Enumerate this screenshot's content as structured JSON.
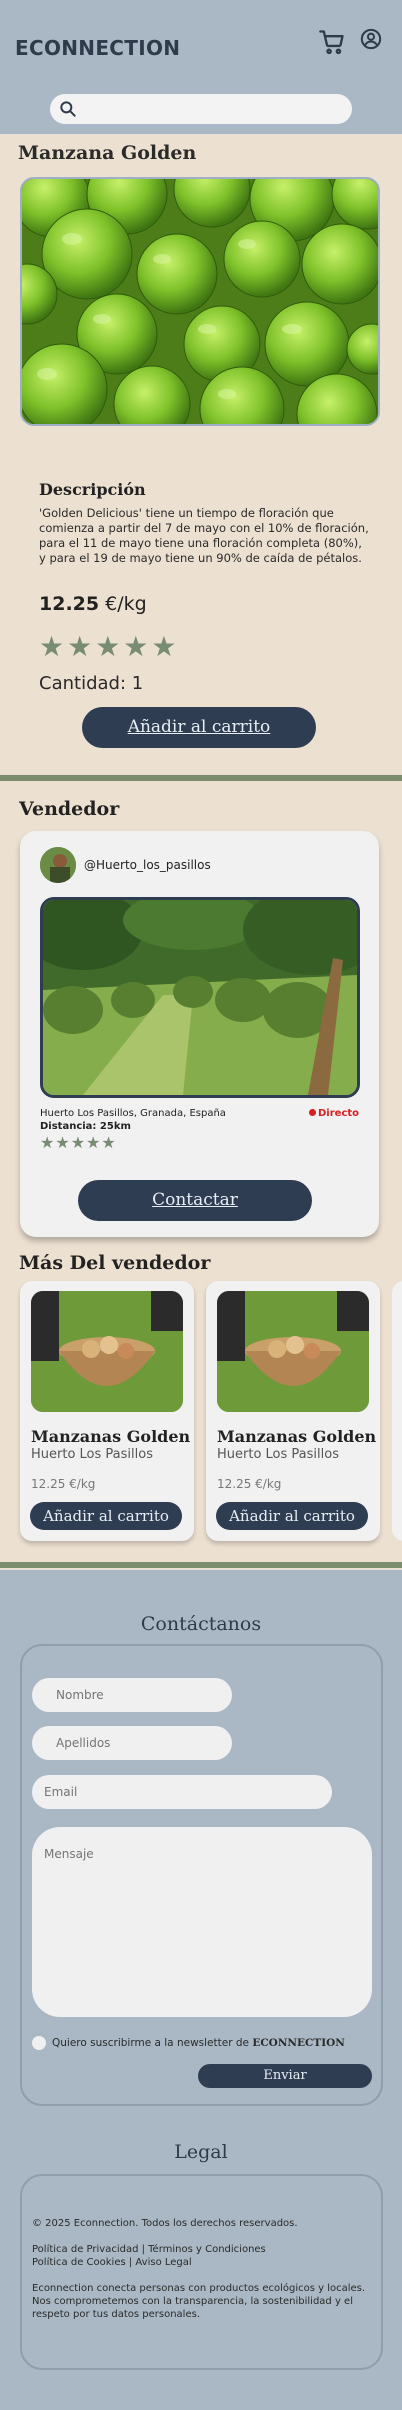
{
  "header": {
    "brand": "ECONNECTION",
    "cart_icon": "cart-icon",
    "user_icon": "user-icon",
    "search_placeholder": ""
  },
  "product": {
    "title": "Manzana Golden",
    "image": "green-apples-photo",
    "description_title": "Descripción",
    "description": "'Golden Delicious' tiene un tiempo de floración que comienza a partir del 7 de mayo con el 10% de floración, para el 11 de mayo tiene una floración completa (80%), y para el 19 de mayo tiene un 90% de caída de pétalos.",
    "price_value": "12.25",
    "price_unit": " €/kg",
    "rating": 5,
    "stars": "★★★★★",
    "quantity": "Cantidad: 1",
    "add_button": "Añadir al carrito"
  },
  "vendor": {
    "section_title": "Vendedor",
    "handle": "@Huerto_los_pasillos",
    "location": "Huerto Los Pasillos, Granada, España",
    "distance": "Distancia: 25km",
    "live": "Directo",
    "rating": 5,
    "stars": "★★★★★",
    "contact_button": "Contactar"
  },
  "more": {
    "section_title": "Más Del vendedor",
    "items": [
      {
        "title": "Manzanas Golden",
        "seller": "Huerto Los Pasillos",
        "price": "12.25 €/kg",
        "button": "Añadir al carrito"
      },
      {
        "title": "Manzanas Golden",
        "seller": "Huerto Los Pasillos",
        "price": "12.25 €/kg",
        "button": "Añadir al carrito"
      }
    ]
  },
  "contact": {
    "heading": "Contáctanos",
    "nombre_placeholder": "Nombre",
    "apellidos_placeholder": "Apellidos",
    "email_placeholder": "Email",
    "mensaje_placeholder": "Mensaje",
    "newsletter_text": "Quiero suscribirme a la newsletter de ",
    "newsletter_brand": "ECONNECTION",
    "send_button": "Enviar"
  },
  "legal": {
    "heading": "Legal",
    "copyright": "© 2025 Econnection. Todos los derechos reservados.",
    "links_line1": "Política de Privacidad | Términos y Condiciones",
    "links_line2": "Política de Cookies | Aviso Legal",
    "about": "Econnection conecta personas con productos ecológicos y locales. Nos comprometemos con la transparencia, la sostenibilidad y el respeto por tus datos personales."
  },
  "colors": {
    "header_bg": "#a9b8c4",
    "page_bg": "#ece0d1",
    "button_dark": "#2f3d52",
    "divider_green": "#7b8d6c",
    "star_green": "#788b73",
    "live_red": "#d81e1e"
  }
}
